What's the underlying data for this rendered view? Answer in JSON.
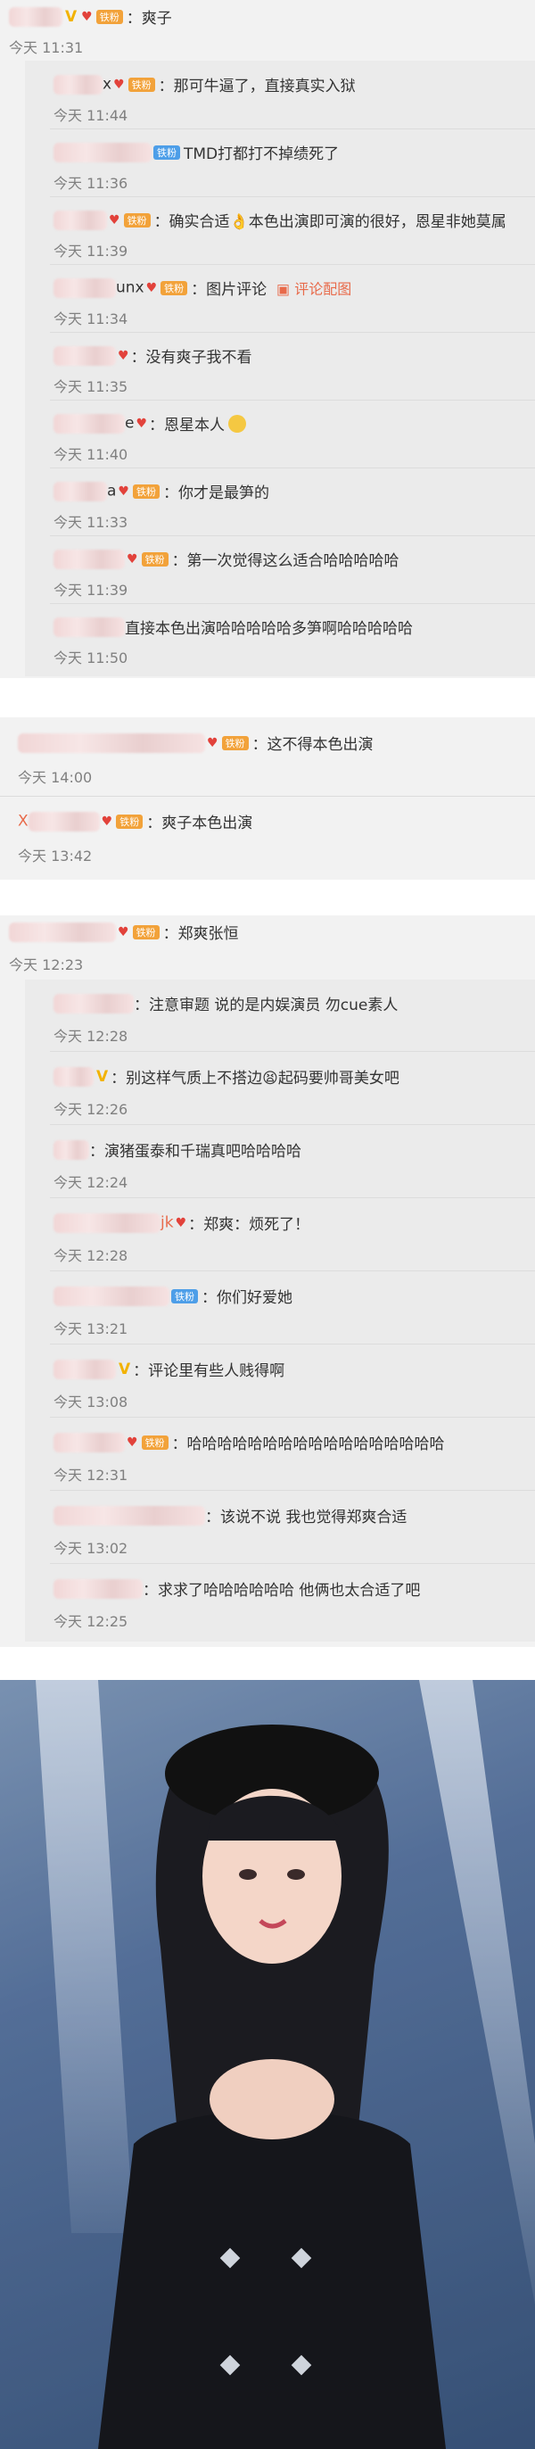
{
  "post1": {
    "main": {
      "text": "：爽子",
      "time": "今天 11:31"
    },
    "replies": [
      {
        "name_tail": "x",
        "badge": "铁粉",
        "text": "：那可牛逼了，直接真实入狱",
        "time": "今天 11:44"
      },
      {
        "name_tail": "",
        "badge": "铁粉",
        "text": "TMD打都打不掉绩死了",
        "time": "今天 11:36"
      },
      {
        "name_tail": "",
        "badge": "铁粉",
        "text": "：确实合适👌本色出演即可演的很好，恩星非她莫属",
        "time": "今天 11:39"
      },
      {
        "name_tail": "unx",
        "badge": "铁粉",
        "text": "：图片评论",
        "link": "评论配图",
        "time": "今天 11:34"
      },
      {
        "name_tail": "",
        "badge": "",
        "text": "：没有爽子我不看",
        "time": "今天 11:35"
      },
      {
        "name_tail": "e",
        "badge": "",
        "text": "：恩星本人",
        "time": "今天 11:40"
      },
      {
        "name_tail": "a",
        "badge": "铁粉",
        "text": "：你才是最笋的",
        "time": "今天 11:33"
      },
      {
        "name_tail": "",
        "badge": "铁粉",
        "text": "：第一次觉得这么适合哈哈哈哈哈",
        "time": "今天 11:39"
      },
      {
        "name_tail": "",
        "badge": "",
        "text": "直接本色出演哈哈哈哈哈多笋啊哈哈哈哈哈",
        "time": "今天 11:50"
      }
    ]
  },
  "post2": {
    "comments": [
      {
        "name_tail": "",
        "badge": "铁粉",
        "text": "：这不得本色出演",
        "time": "今天 14:00"
      },
      {
        "name_tail": "X",
        "badge": "铁粉",
        "text": "：爽子本色出演",
        "time": "今天 13:42"
      }
    ]
  },
  "post3": {
    "main": {
      "badge": "铁粉",
      "text": "：郑爽张恒",
      "time": "今天 12:23"
    },
    "replies": [
      {
        "name_tail": "",
        "badge": "",
        "text": "：注意审题 说的是内娱演员  勿cue素人",
        "time": "今天 12:28"
      },
      {
        "name_tail": "V",
        "badge": "",
        "text": "：别这样气质上不搭边😫起码要帅哥美女吧",
        "time": "今天 12:26"
      },
      {
        "name_tail": "",
        "badge": "",
        "text": "：演猪蛋泰和千瑞真吧哈哈哈哈",
        "time": "今天 12:24"
      },
      {
        "name_tail": "jk",
        "badge": "",
        "text": "：郑爽：烦死了！",
        "time": "今天 12:28"
      },
      {
        "name_tail": "",
        "badge": "铁粉",
        "text": "：你们好爱她",
        "time": "今天 13:21"
      },
      {
        "name_tail": "V",
        "badge": "",
        "text": "：评论里有些人贱得啊",
        "time": "今天 13:08"
      },
      {
        "name_tail": "",
        "badge": "铁粉",
        "text": "：哈哈哈哈哈哈哈哈哈哈哈哈哈哈哈哈哈",
        "time": "今天 12:31"
      },
      {
        "name_tail": "",
        "badge": "",
        "text": "：该说不说 我也觉得郑爽合适",
        "time": "今天 13:02"
      },
      {
        "name_tail": "",
        "badge": "",
        "text": "：求求了哈哈哈哈哈哈 他俩也太合适了吧",
        "time": "今天 12:25"
      }
    ]
  },
  "colors": {
    "badge": "#f2a23a",
    "badge_blue": "#4d9ee8",
    "time": "#808080",
    "vip": "#f2b200"
  }
}
